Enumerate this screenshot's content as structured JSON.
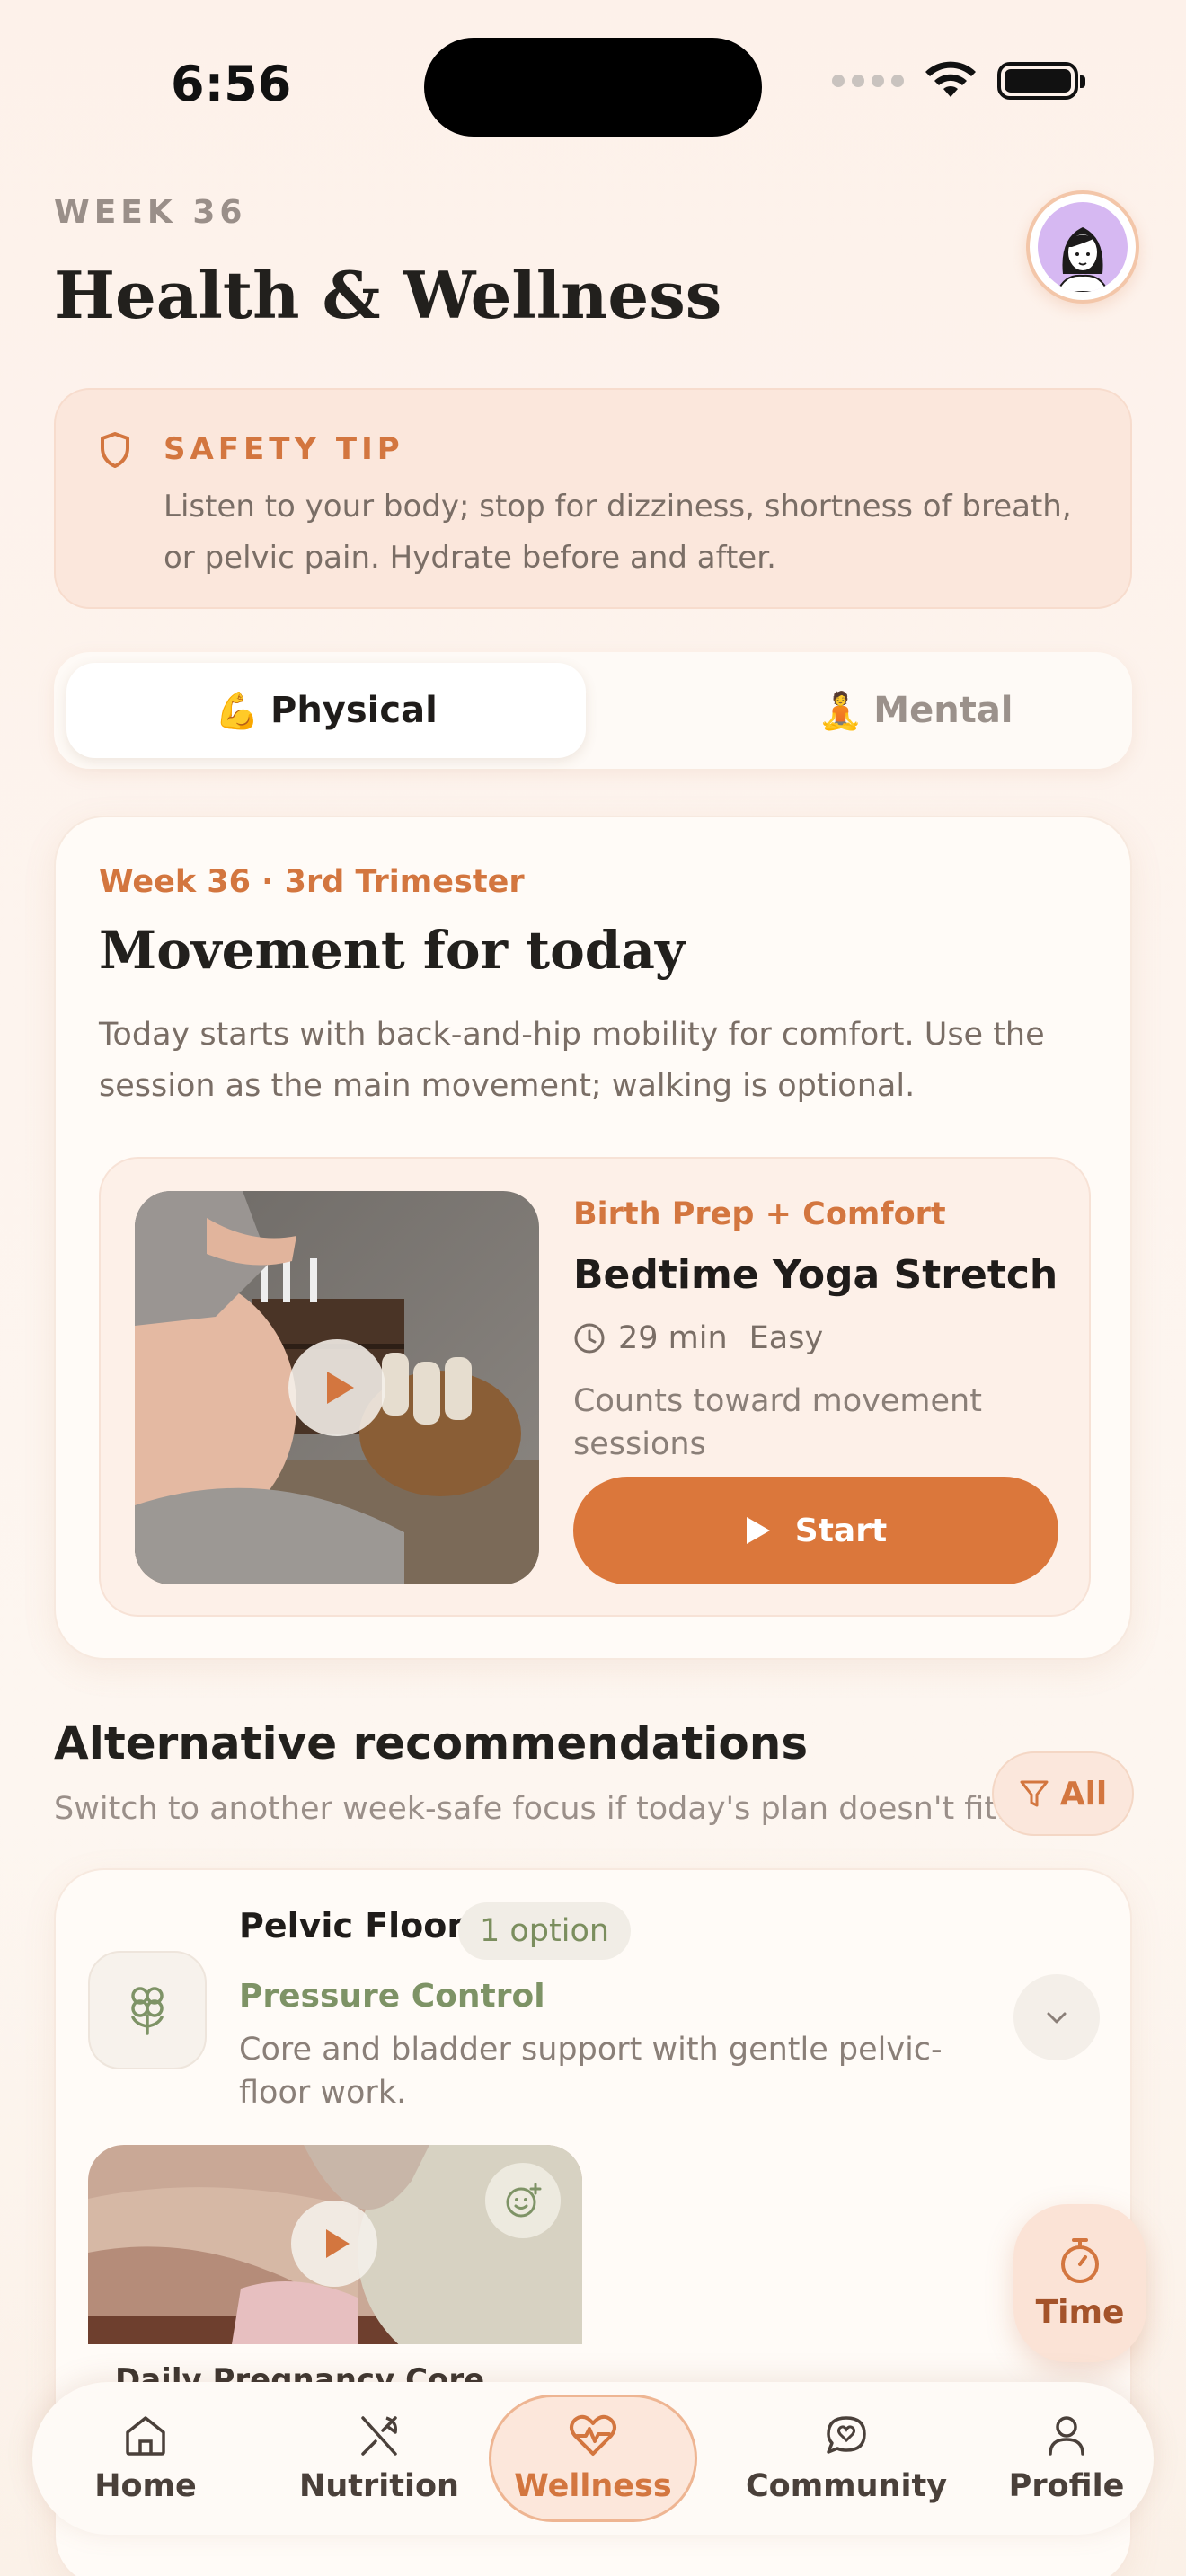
{
  "status": {
    "time": "6:56"
  },
  "header": {
    "week_label": "WEEK 36",
    "title": "Health & Wellness"
  },
  "safety_tip": {
    "title": "SAFETY TIP",
    "body": "Listen to your body; stop for dizziness, shortness of breath, or pelvic pain. Hydrate before and after."
  },
  "tabs": [
    {
      "emoji": "💪",
      "label": "Physical",
      "active": true
    },
    {
      "emoji": "🧘",
      "label": "Mental",
      "active": false
    }
  ],
  "movement": {
    "meta": "Week 36 · 3rd Trimester",
    "title": "Movement for today",
    "description": "Today starts with back-and-hip mobility for comfort. Use the session as the main movement; walking is optional.",
    "session": {
      "category": "Birth Prep + Comfort",
      "title": "Bedtime Yoga Stretch",
      "duration": "29 min",
      "difficulty": "Easy",
      "note": "Counts toward movement sessions",
      "start_label": "Start"
    }
  },
  "alternatives": {
    "title": "Alternative recommendations",
    "subtitle": "Switch to another week-safe focus if today's plan doesn't fit.",
    "filter_label": "All",
    "item": {
      "name": "Pelvic Floor",
      "badge": "1 option",
      "focus": "Pressure Control",
      "description": "Core and bladder support with gentle pelvic-floor work.",
      "video_title": "Daily Pregnancy Core"
    }
  },
  "fab": {
    "label": "Time"
  },
  "nav": [
    {
      "label": "Home",
      "icon": "home-icon"
    },
    {
      "label": "Nutrition",
      "icon": "fork-knife-icon"
    },
    {
      "label": "Wellness",
      "icon": "heart-pulse-icon",
      "active": true
    },
    {
      "label": "Community",
      "icon": "chat-heart-icon"
    },
    {
      "label": "Profile",
      "icon": "person-icon"
    }
  ],
  "colors": {
    "accent": "#db773b",
    "sage": "#7e9366",
    "background": "#fdf4ee"
  }
}
